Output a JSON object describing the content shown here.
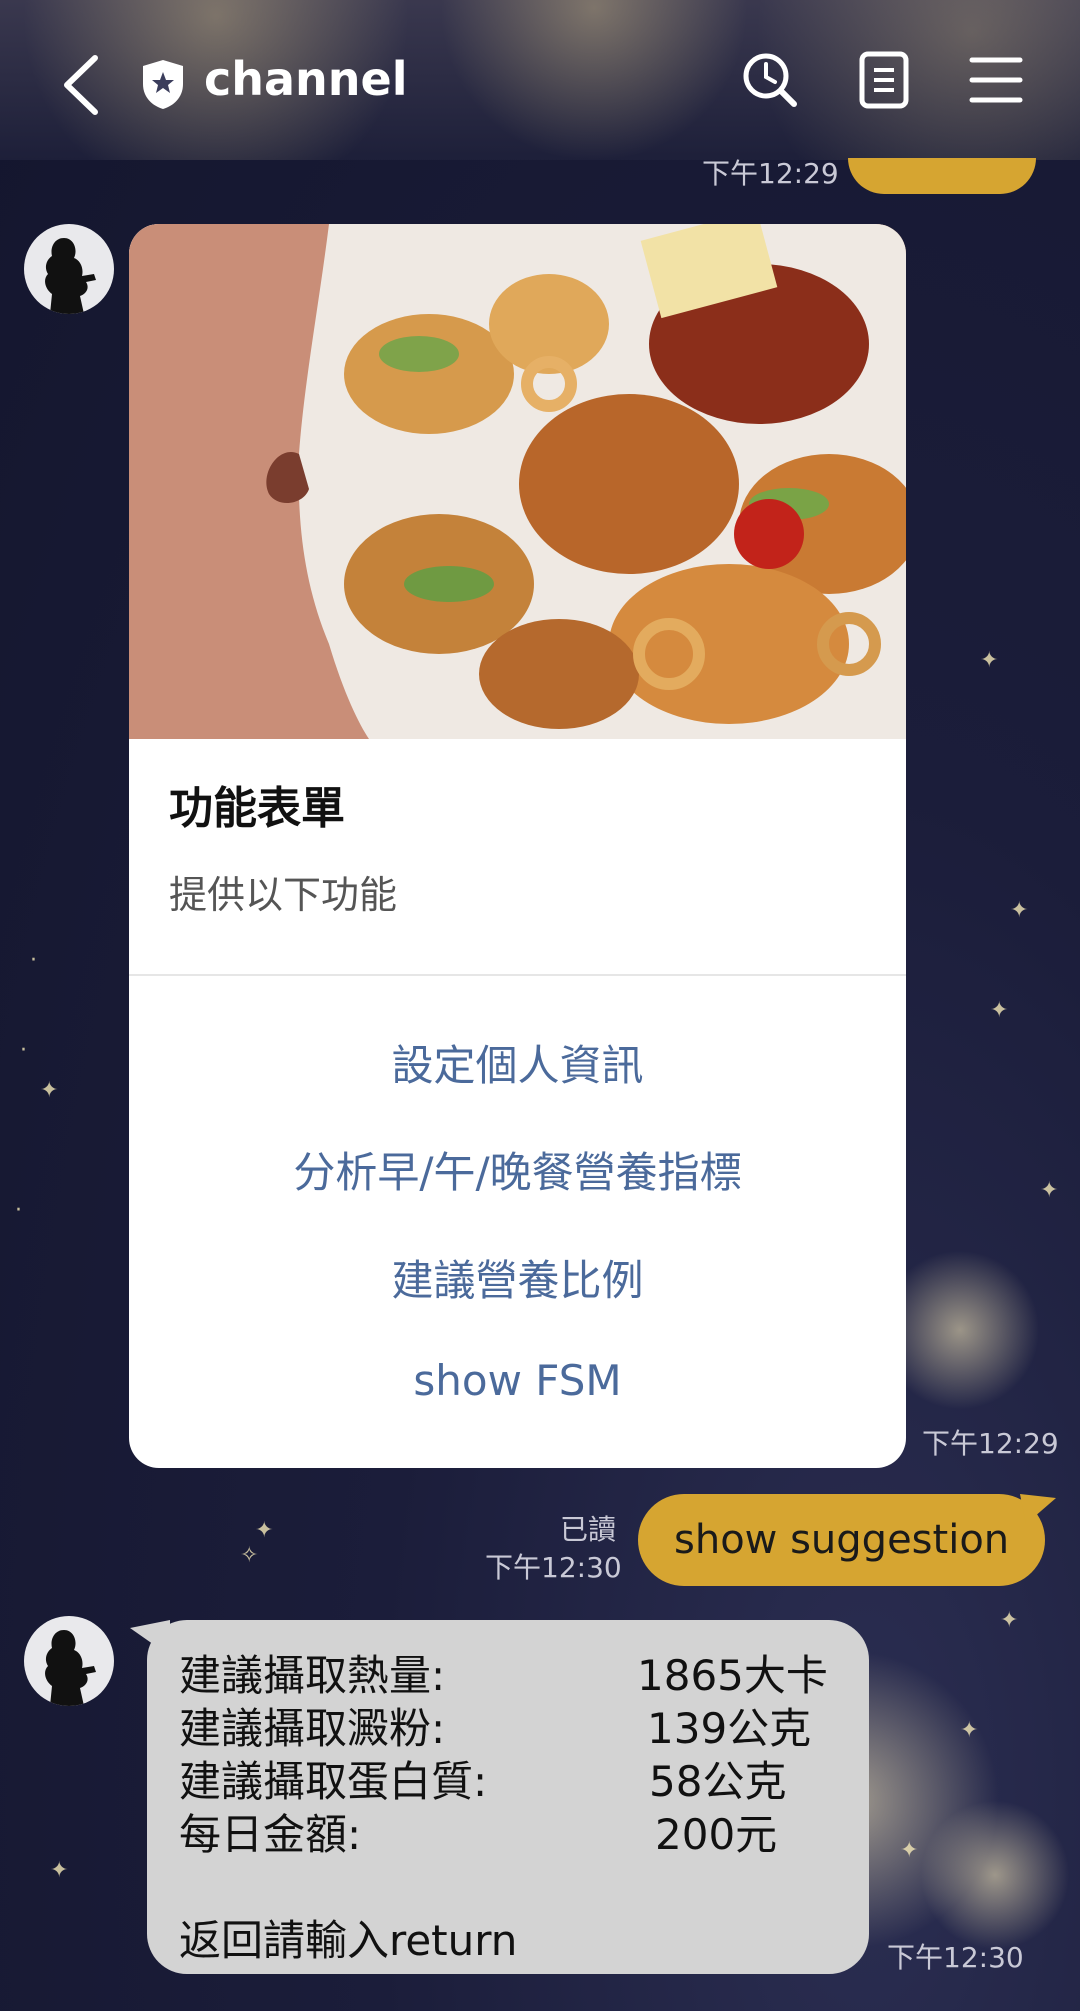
{
  "header": {
    "title": "channel",
    "icons": [
      "back-arrow-icon",
      "shield-icon",
      "clock-search-icon",
      "note-icon",
      "menu-icon"
    ]
  },
  "messages": {
    "top_time": "下午12:29",
    "card": {
      "title": "功能表單",
      "subtitle": "提供以下功能",
      "buttons": [
        "設定個人資訊",
        "分析早/午/晚餐營養指標",
        "建議營養比例",
        "show FSM"
      ]
    },
    "card_time": "下午12:29",
    "user_msg": {
      "read": "已讀",
      "time": "下午12:30",
      "text": "show suggestion"
    },
    "bot_reply": {
      "rows": [
        {
          "label": "建議攝取熱量:",
          "value": "1865大卡"
        },
        {
          "label": "建議攝取澱粉:",
          "value": "139公克"
        },
        {
          "label": "建議攝取蛋白質:",
          "value": "58公克"
        },
        {
          "label": "每日金額:",
          "value": "200元"
        }
      ],
      "footer": "返回請輸入return",
      "time": "下午12:30"
    }
  },
  "colors": {
    "background": "#1b1d3a",
    "user_bubble": "#d6a531",
    "bot_bubble": "#d3d3d3",
    "card_button_text": "#4b6a9b"
  }
}
